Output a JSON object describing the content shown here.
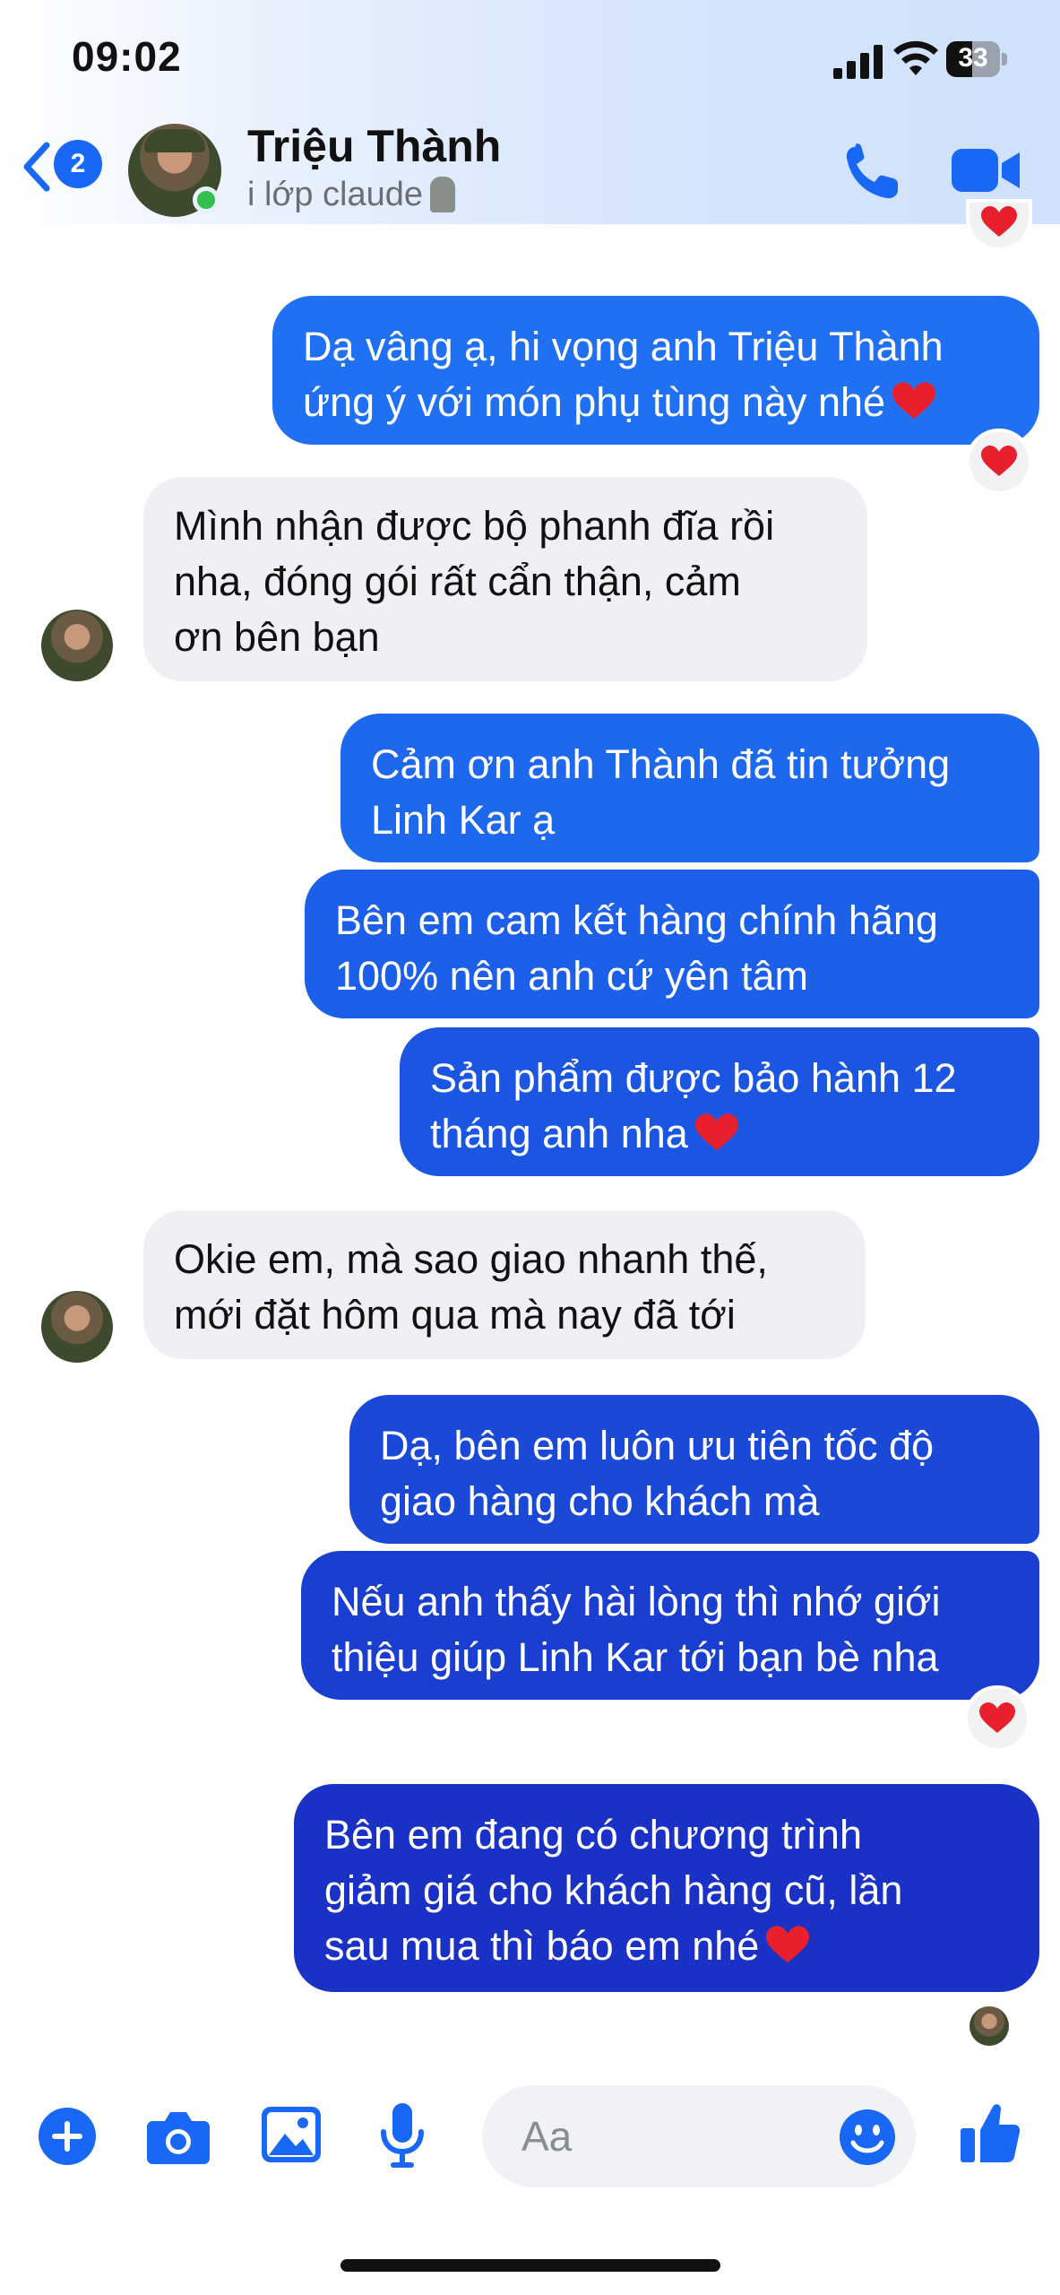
{
  "status_bar": {
    "time": "09:02",
    "battery": "33"
  },
  "header": {
    "back_badge_count": "2",
    "contact_name": "Triệu Thành",
    "subtitle": "i lớp claude",
    "online": true
  },
  "colors": {
    "outgoing_top": "#1f6ff0",
    "outgoing_bottom": "#1a2fc4",
    "incoming": "#eef0f3",
    "accent": "#1868f5",
    "reaction_heart": "#e8202e"
  },
  "messages": [
    {
      "id": "m1",
      "from": "me",
      "text": "Dạ vâng ạ, hi vọng anh Triệu Thành\nứng ý với món phụ tùng này nhé",
      "emoji": "red-heart",
      "reaction": "red-heart"
    },
    {
      "id": "m2",
      "from": "contact",
      "text": "Mình nhận được bộ phanh đĩa rồi\nnha, đóng gói rất cẩn thận, cảm\nơn bên bạn"
    },
    {
      "id": "m3",
      "from": "me",
      "text": "Cảm ơn anh Thành đã tin tưởng\nLinh Kar ạ"
    },
    {
      "id": "m4",
      "from": "me",
      "text": "Bên em cam kết hàng chính hãng\n100% nên anh cứ yên tâm"
    },
    {
      "id": "m5",
      "from": "me",
      "text": "Sản phẩm được bảo hành 12\ntháng anh nha",
      "emoji": "red-heart"
    },
    {
      "id": "m6",
      "from": "contact",
      "text": "Okie em, mà sao giao nhanh thế,\nmới đặt hôm qua mà nay đã tới"
    },
    {
      "id": "m7",
      "from": "me",
      "text": "Dạ, bên em luôn ưu tiên tốc độ\ngiao hàng cho khách mà"
    },
    {
      "id": "m8",
      "from": "me",
      "text": "Nếu anh thấy hài lòng thì nhớ giới\nthiệu giúp Linh Kar tới bạn bè nha",
      "reaction": "red-heart"
    },
    {
      "id": "m9",
      "from": "me",
      "text": "Bên em đang có chương trình\ngiảm  giá cho khách hàng cũ, lần\nsau mua thì báo em nhé",
      "emoji": "red-heart"
    }
  ],
  "composer": {
    "placeholder": "Aa",
    "icons": [
      "plus-icon",
      "camera-icon",
      "gallery-icon",
      "microphone-icon",
      "emoji-icon",
      "thumbs-up-icon"
    ]
  }
}
